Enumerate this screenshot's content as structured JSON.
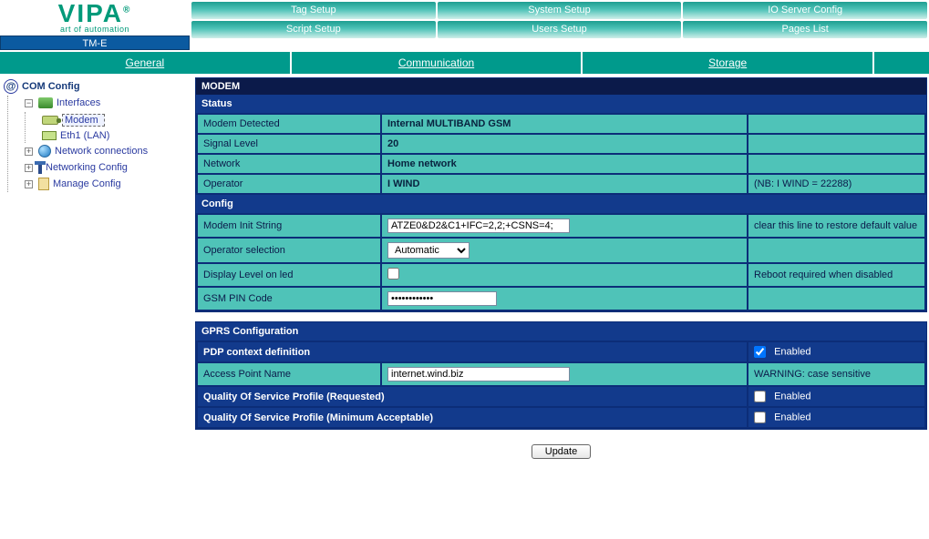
{
  "brand": {
    "name": "VIPA",
    "tagline": "art of automation",
    "product": "TM-E"
  },
  "top_tabs_row1": [
    "Tag Setup",
    "System Setup",
    "IO Server Config"
  ],
  "top_tabs_row2": [
    "Script Setup",
    "Users Setup",
    "Pages List"
  ],
  "subnav": {
    "general": "General",
    "communication": "Communication",
    "storage": "Storage"
  },
  "sidebar": {
    "root": "COM Config",
    "items": [
      {
        "label": "Interfaces",
        "expanded": true,
        "children": [
          {
            "label": "Modem",
            "selected": true
          },
          {
            "label": "Eth1 (LAN)"
          }
        ]
      },
      {
        "label": "Network connections"
      },
      {
        "label": "Networking Config"
      },
      {
        "label": "Manage Config"
      }
    ]
  },
  "modem": {
    "title": "MODEM",
    "status_header": "Status",
    "status": {
      "modem_detected_k": "Modem Detected",
      "modem_detected_v": "Internal MULTIBAND GSM",
      "signal_level_k": "Signal Level",
      "signal_level_v": "20",
      "network_k": "Network",
      "network_v": "Home network",
      "operator_k": "Operator",
      "operator_v": "I WIND",
      "operator_note": "(NB: I WIND = 22288)"
    },
    "config_header": "Config",
    "config": {
      "init_k": "Modem Init String",
      "init_v": "ATZE0&D2&C1+IFC=2,2;+CSNS=4;",
      "init_note": "clear this line to restore default value",
      "opsel_k": "Operator selection",
      "opsel_v": "Automatic",
      "displed_k": "Display Level on led",
      "displed_checked": false,
      "displed_note": "Reboot required when disabled",
      "pin_k": "GSM PIN Code",
      "pin_v": "••••••••••••"
    }
  },
  "gprs": {
    "title": "GPRS Configuration",
    "pdp_k": "PDP context definition",
    "pdp_enabled": true,
    "enabled_label": "Enabled",
    "apn_k": "Access Point Name",
    "apn_v": "internet.wind.biz",
    "apn_note": "WARNING: case sensitive",
    "qos_req_k": "Quality Of Service Profile (Requested)",
    "qos_req_enabled": false,
    "qos_min_k": "Quality Of Service Profile (Minimum Acceptable)",
    "qos_min_enabled": false
  },
  "buttons": {
    "update": "Update"
  }
}
